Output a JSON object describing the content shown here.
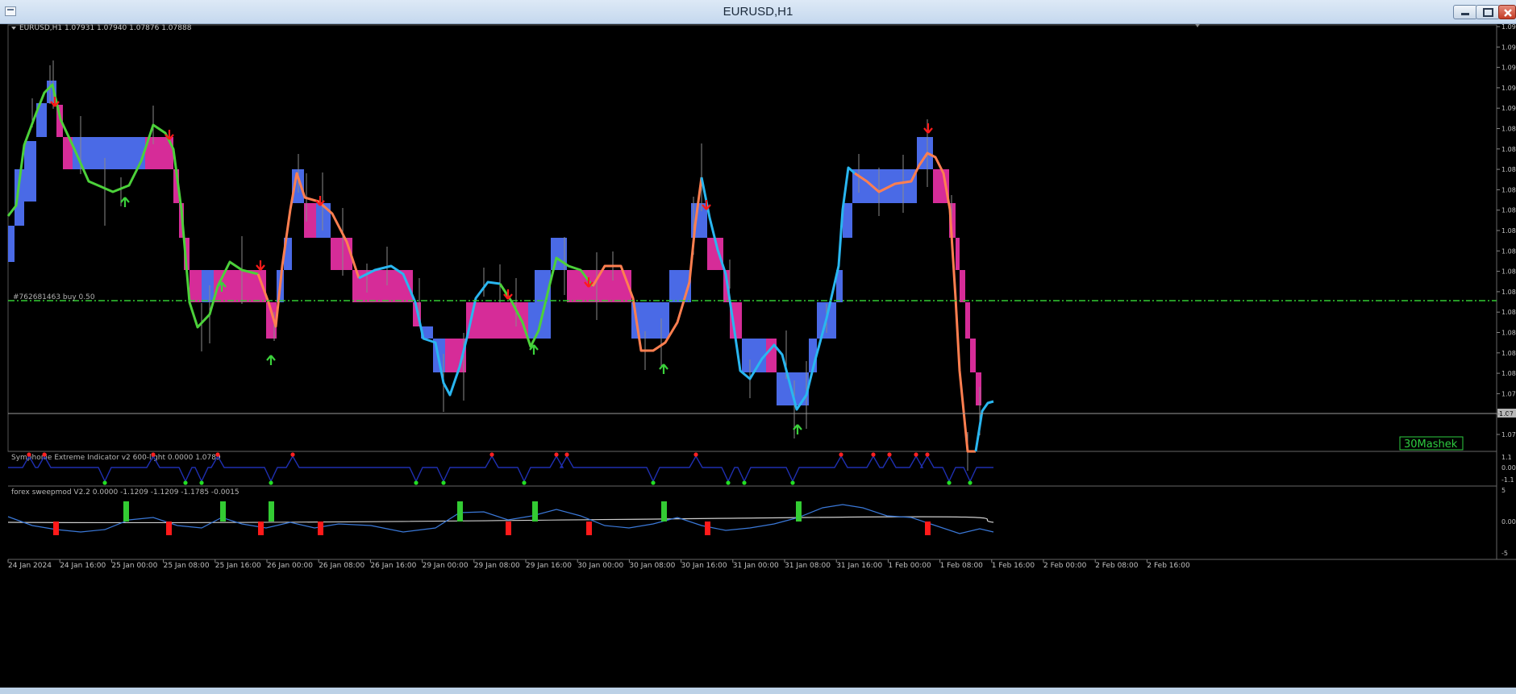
{
  "window": {
    "title": "EURUSD,H1",
    "controls": [
      "minimize",
      "restore",
      "close"
    ]
  },
  "chart": {
    "info_line": "EURUSD,H1  1.07931 1.07940 1.07876 1.07888",
    "trade_line_label": "#762681463 buy 0.50",
    "brand_label": "30Mashek",
    "price_axis_labels": [
      "1.09",
      "1.09",
      "1.09",
      "1.09",
      "1.09",
      "1.08",
      "1.08",
      "1.08",
      "1.08",
      "1.08",
      "1.08",
      "1.08",
      "1.08",
      "1.08",
      "1.08",
      "1.08",
      "1.08",
      "1.08",
      "1.07",
      "1.07",
      "1.07"
    ],
    "current_price_label": "1.07",
    "colors": {
      "background": "#000000",
      "box_up": "#4a6ae6",
      "box_down": "#d62c98",
      "line_up": "#29b6f0",
      "line_down": "#ff7f50",
      "line_mid": "#4cd13a",
      "arrow_up": "#3bd23b",
      "arrow_down": "#ff1a1a",
      "trade_line": "#33cc33"
    }
  },
  "indicator1": {
    "label": "Symphonie Extreme Indicator v2 600-light 0.0000 1.0789",
    "scale": [
      "1.1",
      "0.00",
      "-1.1"
    ]
  },
  "indicator2": {
    "label": "forex sweepmod V2.2 0.0000 -1.1209 -1.1209 -1.1785 -0.0015",
    "scale": [
      "5",
      "0.00",
      "-5"
    ]
  },
  "time_axis": [
    "24 Jan 2024",
    "24 Jan 16:00",
    "25 Jan 00:00",
    "25 Jan 08:00",
    "25 Jan 16:00",
    "26 Jan 00:00",
    "26 Jan 08:00",
    "26 Jan 16:00",
    "29 Jan 00:00",
    "29 Jan 08:00",
    "29 Jan 16:00",
    "30 Jan 00:00",
    "30 Jan 08:00",
    "30 Jan 16:00",
    "31 Jan 00:00",
    "31 Jan 08:00",
    "31 Jan 16:00",
    "1 Feb 00:00",
    "1 Feb 08:00",
    "1 Feb 16:00",
    "2 Feb 00:00",
    "2 Feb 08:00",
    "2 Feb 16:00"
  ]
}
